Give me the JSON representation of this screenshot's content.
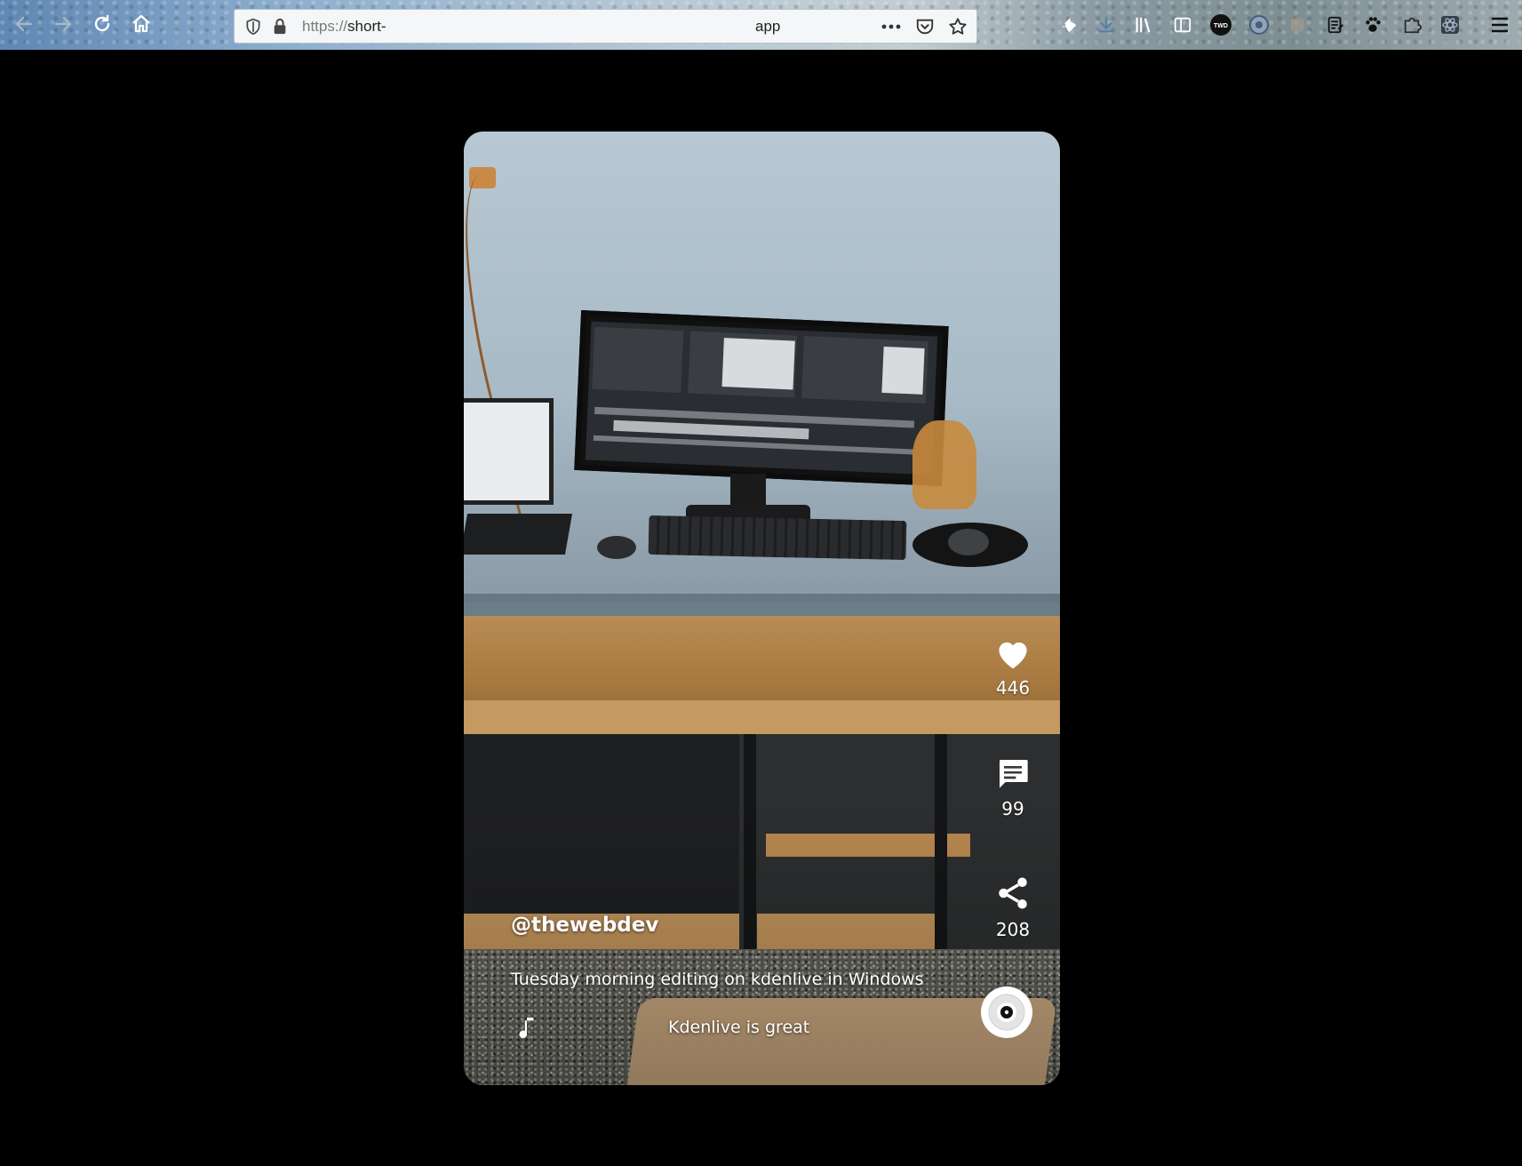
{
  "browser": {
    "url_scheme": "https://",
    "url_host_start": "short-",
    "url_host_end": "app",
    "nav": {
      "back_icon": "arrow-left-icon",
      "forward_icon": "arrow-right-icon",
      "reload_icon": "reload-icon",
      "home_icon": "home-icon"
    },
    "urlbar_icons": [
      "shield-icon",
      "lock-icon",
      "more-dots-icon",
      "pocket-icon",
      "bookmark-star-icon"
    ],
    "extensions": [
      "wrench-icon",
      "download-icon",
      "library-icon",
      "sidebar-icon",
      "twd-badge-icon",
      "extension-circle-icon",
      "extension-square-icon",
      "notes-icon",
      "paw-icon",
      "puzzle-icon",
      "react-devtools-icon",
      "hamburger-menu-icon"
    ],
    "twd_badge_text": "TWD"
  },
  "video": {
    "username": "@thewebdev",
    "caption": "Tuesday morning editing on kdenlive in Windows",
    "song": "Kdenlive is great",
    "actions": {
      "likes": "446",
      "comments": "99",
      "shares": "208"
    }
  },
  "colors": {
    "page_background": "#000000",
    "overlay_text": "#ffffff"
  }
}
